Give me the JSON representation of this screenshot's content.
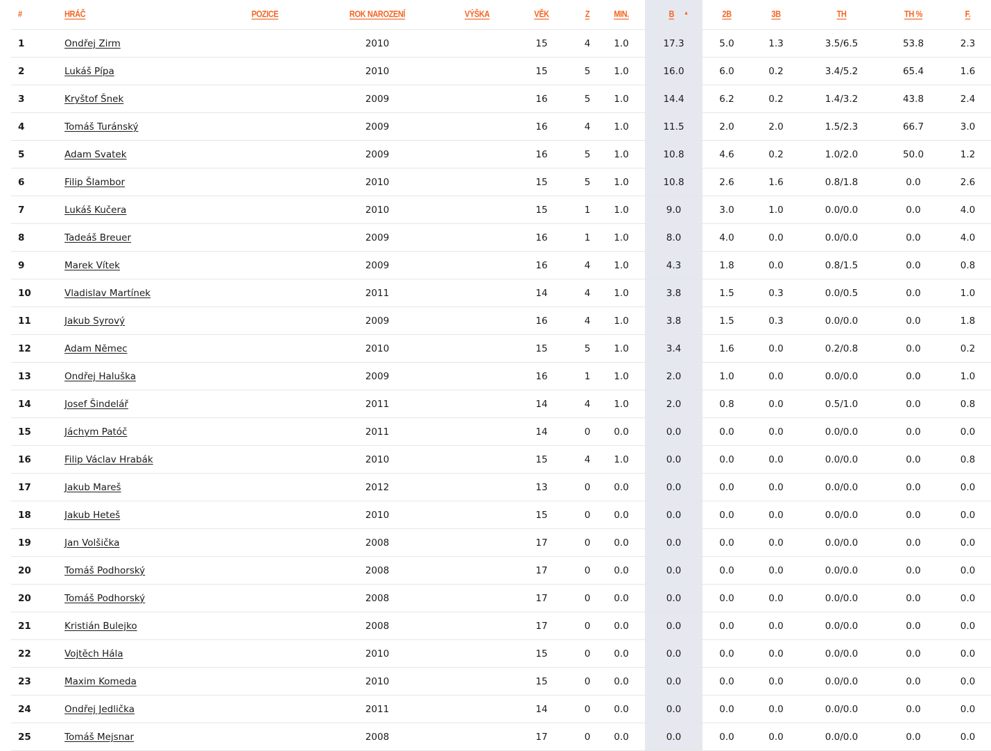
{
  "columns": {
    "rank": "#",
    "player": "Hráč",
    "position": "Pozice",
    "birth_year": "Rok narození",
    "height": "Výška",
    "age": "Věk",
    "games": "Z",
    "minutes": "Min.",
    "points": "B",
    "two_pt": "2B",
    "three_pt": "3B",
    "free_throws": "TH",
    "free_throw_pct": "TH %",
    "fouls": "F."
  },
  "sort_arrow": "▲",
  "rows": [
    {
      "rank": "1",
      "player": "Ondřej Zirm",
      "position": "",
      "birth_year": "2010",
      "height": "",
      "age": "15",
      "games": "4",
      "minutes": "1.0",
      "points": "17.3",
      "two_pt": "5.0",
      "three_pt": "1.3",
      "free_throws": "3.5/6.5",
      "free_throw_pct": "53.8",
      "fouls": "2.3"
    },
    {
      "rank": "2",
      "player": "Lukáš Pípa",
      "position": "",
      "birth_year": "2010",
      "height": "",
      "age": "15",
      "games": "5",
      "minutes": "1.0",
      "points": "16.0",
      "two_pt": "6.0",
      "three_pt": "0.2",
      "free_throws": "3.4/5.2",
      "free_throw_pct": "65.4",
      "fouls": "1.6"
    },
    {
      "rank": "3",
      "player": "Kryštof Šnek",
      "position": "",
      "birth_year": "2009",
      "height": "",
      "age": "16",
      "games": "5",
      "minutes": "1.0",
      "points": "14.4",
      "two_pt": "6.2",
      "three_pt": "0.2",
      "free_throws": "1.4/3.2",
      "free_throw_pct": "43.8",
      "fouls": "2.4"
    },
    {
      "rank": "4",
      "player": "Tomáš Turánský",
      "position": "",
      "birth_year": "2009",
      "height": "",
      "age": "16",
      "games": "4",
      "minutes": "1.0",
      "points": "11.5",
      "two_pt": "2.0",
      "three_pt": "2.0",
      "free_throws": "1.5/2.3",
      "free_throw_pct": "66.7",
      "fouls": "3.0"
    },
    {
      "rank": "5",
      "player": "Adam Svatek",
      "position": "",
      "birth_year": "2009",
      "height": "",
      "age": "16",
      "games": "5",
      "minutes": "1.0",
      "points": "10.8",
      "two_pt": "4.6",
      "three_pt": "0.2",
      "free_throws": "1.0/2.0",
      "free_throw_pct": "50.0",
      "fouls": "1.2"
    },
    {
      "rank": "6",
      "player": "Filip Šlambor",
      "position": "",
      "birth_year": "2010",
      "height": "",
      "age": "15",
      "games": "5",
      "minutes": "1.0",
      "points": "10.8",
      "two_pt": "2.6",
      "three_pt": "1.6",
      "free_throws": "0.8/1.8",
      "free_throw_pct": "0.0",
      "fouls": "2.6"
    },
    {
      "rank": "7",
      "player": "Lukáš Kučera",
      "position": "",
      "birth_year": "2010",
      "height": "",
      "age": "15",
      "games": "1",
      "minutes": "1.0",
      "points": "9.0",
      "two_pt": "3.0",
      "three_pt": "1.0",
      "free_throws": "0.0/0.0",
      "free_throw_pct": "0.0",
      "fouls": "4.0"
    },
    {
      "rank": "8",
      "player": "Tadeáš Breuer",
      "position": "",
      "birth_year": "2009",
      "height": "",
      "age": "16",
      "games": "1",
      "minutes": "1.0",
      "points": "8.0",
      "two_pt": "4.0",
      "three_pt": "0.0",
      "free_throws": "0.0/0.0",
      "free_throw_pct": "0.0",
      "fouls": "4.0"
    },
    {
      "rank": "9",
      "player": "Marek Vítek",
      "position": "",
      "birth_year": "2009",
      "height": "",
      "age": "16",
      "games": "4",
      "minutes": "1.0",
      "points": "4.3",
      "two_pt": "1.8",
      "three_pt": "0.0",
      "free_throws": "0.8/1.5",
      "free_throw_pct": "0.0",
      "fouls": "0.8"
    },
    {
      "rank": "10",
      "player": "Vladislav Martínek",
      "position": "",
      "birth_year": "2011",
      "height": "",
      "age": "14",
      "games": "4",
      "minutes": "1.0",
      "points": "3.8",
      "two_pt": "1.5",
      "three_pt": "0.3",
      "free_throws": "0.0/0.5",
      "free_throw_pct": "0.0",
      "fouls": "1.0"
    },
    {
      "rank": "11",
      "player": "Jakub Syrový",
      "position": "",
      "birth_year": "2009",
      "height": "",
      "age": "16",
      "games": "4",
      "minutes": "1.0",
      "points": "3.8",
      "two_pt": "1.5",
      "three_pt": "0.3",
      "free_throws": "0.0/0.0",
      "free_throw_pct": "0.0",
      "fouls": "1.8"
    },
    {
      "rank": "12",
      "player": "Adam Němec",
      "position": "",
      "birth_year": "2010",
      "height": "",
      "age": "15",
      "games": "5",
      "minutes": "1.0",
      "points": "3.4",
      "two_pt": "1.6",
      "three_pt": "0.0",
      "free_throws": "0.2/0.8",
      "free_throw_pct": "0.0",
      "fouls": "0.2"
    },
    {
      "rank": "13",
      "player": "Ondřej Haluška",
      "position": "",
      "birth_year": "2009",
      "height": "",
      "age": "16",
      "games": "1",
      "minutes": "1.0",
      "points": "2.0",
      "two_pt": "1.0",
      "three_pt": "0.0",
      "free_throws": "0.0/0.0",
      "free_throw_pct": "0.0",
      "fouls": "1.0"
    },
    {
      "rank": "14",
      "player": "Josef Šindelář",
      "position": "",
      "birth_year": "2011",
      "height": "",
      "age": "14",
      "games": "4",
      "minutes": "1.0",
      "points": "2.0",
      "two_pt": "0.8",
      "three_pt": "0.0",
      "free_throws": "0.5/1.0",
      "free_throw_pct": "0.0",
      "fouls": "0.8"
    },
    {
      "rank": "15",
      "player": "Jáchym Patóč",
      "position": "",
      "birth_year": "2011",
      "height": "",
      "age": "14",
      "games": "0",
      "minutes": "0.0",
      "points": "0.0",
      "two_pt": "0.0",
      "three_pt": "0.0",
      "free_throws": "0.0/0.0",
      "free_throw_pct": "0.0",
      "fouls": "0.0"
    },
    {
      "rank": "16",
      "player": "Filip Václav Hrabák",
      "position": "",
      "birth_year": "2010",
      "height": "",
      "age": "15",
      "games": "4",
      "minutes": "1.0",
      "points": "0.0",
      "two_pt": "0.0",
      "three_pt": "0.0",
      "free_throws": "0.0/0.0",
      "free_throw_pct": "0.0",
      "fouls": "0.8"
    },
    {
      "rank": "17",
      "player": "Jakub Mareš",
      "position": "",
      "birth_year": "2012",
      "height": "",
      "age": "13",
      "games": "0",
      "minutes": "0.0",
      "points": "0.0",
      "two_pt": "0.0",
      "three_pt": "0.0",
      "free_throws": "0.0/0.0",
      "free_throw_pct": "0.0",
      "fouls": "0.0"
    },
    {
      "rank": "18",
      "player": "Jakub Heteš",
      "position": "",
      "birth_year": "2010",
      "height": "",
      "age": "15",
      "games": "0",
      "minutes": "0.0",
      "points": "0.0",
      "two_pt": "0.0",
      "three_pt": "0.0",
      "free_throws": "0.0/0.0",
      "free_throw_pct": "0.0",
      "fouls": "0.0"
    },
    {
      "rank": "19",
      "player": "Jan Volšička",
      "position": "",
      "birth_year": "2008",
      "height": "",
      "age": "17",
      "games": "0",
      "minutes": "0.0",
      "points": "0.0",
      "two_pt": "0.0",
      "three_pt": "0.0",
      "free_throws": "0.0/0.0",
      "free_throw_pct": "0.0",
      "fouls": "0.0"
    },
    {
      "rank": "20",
      "player": "Tomáš Podhorský",
      "position": "",
      "birth_year": "2008",
      "height": "",
      "age": "17",
      "games": "0",
      "minutes": "0.0",
      "points": "0.0",
      "two_pt": "0.0",
      "three_pt": "0.0",
      "free_throws": "0.0/0.0",
      "free_throw_pct": "0.0",
      "fouls": "0.0"
    },
    {
      "rank": "20",
      "player": "Tomáš Podhorský",
      "position": "",
      "birth_year": "2008",
      "height": "",
      "age": "17",
      "games": "0",
      "minutes": "0.0",
      "points": "0.0",
      "two_pt": "0.0",
      "three_pt": "0.0",
      "free_throws": "0.0/0.0",
      "free_throw_pct": "0.0",
      "fouls": "0.0"
    },
    {
      "rank": "21",
      "player": "Kristián Bulejko",
      "position": "",
      "birth_year": "2008",
      "height": "",
      "age": "17",
      "games": "0",
      "minutes": "0.0",
      "points": "0.0",
      "two_pt": "0.0",
      "three_pt": "0.0",
      "free_throws": "0.0/0.0",
      "free_throw_pct": "0.0",
      "fouls": "0.0"
    },
    {
      "rank": "22",
      "player": "Vojtěch Hála",
      "position": "",
      "birth_year": "2010",
      "height": "",
      "age": "15",
      "games": "0",
      "minutes": "0.0",
      "points": "0.0",
      "two_pt": "0.0",
      "three_pt": "0.0",
      "free_throws": "0.0/0.0",
      "free_throw_pct": "0.0",
      "fouls": "0.0"
    },
    {
      "rank": "23",
      "player": "Maxim Komeda",
      "position": "",
      "birth_year": "2010",
      "height": "",
      "age": "15",
      "games": "0",
      "minutes": "0.0",
      "points": "0.0",
      "two_pt": "0.0",
      "three_pt": "0.0",
      "free_throws": "0.0/0.0",
      "free_throw_pct": "0.0",
      "fouls": "0.0"
    },
    {
      "rank": "24",
      "player": "Ondřej Jedlička",
      "position": "",
      "birth_year": "2011",
      "height": "",
      "age": "14",
      "games": "0",
      "minutes": "0.0",
      "points": "0.0",
      "two_pt": "0.0",
      "three_pt": "0.0",
      "free_throws": "0.0/0.0",
      "free_throw_pct": "0.0",
      "fouls": "0.0"
    },
    {
      "rank": "25",
      "player": "Tomáš Mejsnar",
      "position": "",
      "birth_year": "2008",
      "height": "",
      "age": "17",
      "games": "0",
      "minutes": "0.0",
      "points": "0.0",
      "two_pt": "0.0",
      "three_pt": "0.0",
      "free_throws": "0.0/0.0",
      "free_throw_pct": "0.0",
      "fouls": "0.0"
    }
  ],
  "colors": {
    "header_accent": "#f26522",
    "sorted_column_bg": "#e6e8ef",
    "row_divider": "#e6e6e6"
  }
}
